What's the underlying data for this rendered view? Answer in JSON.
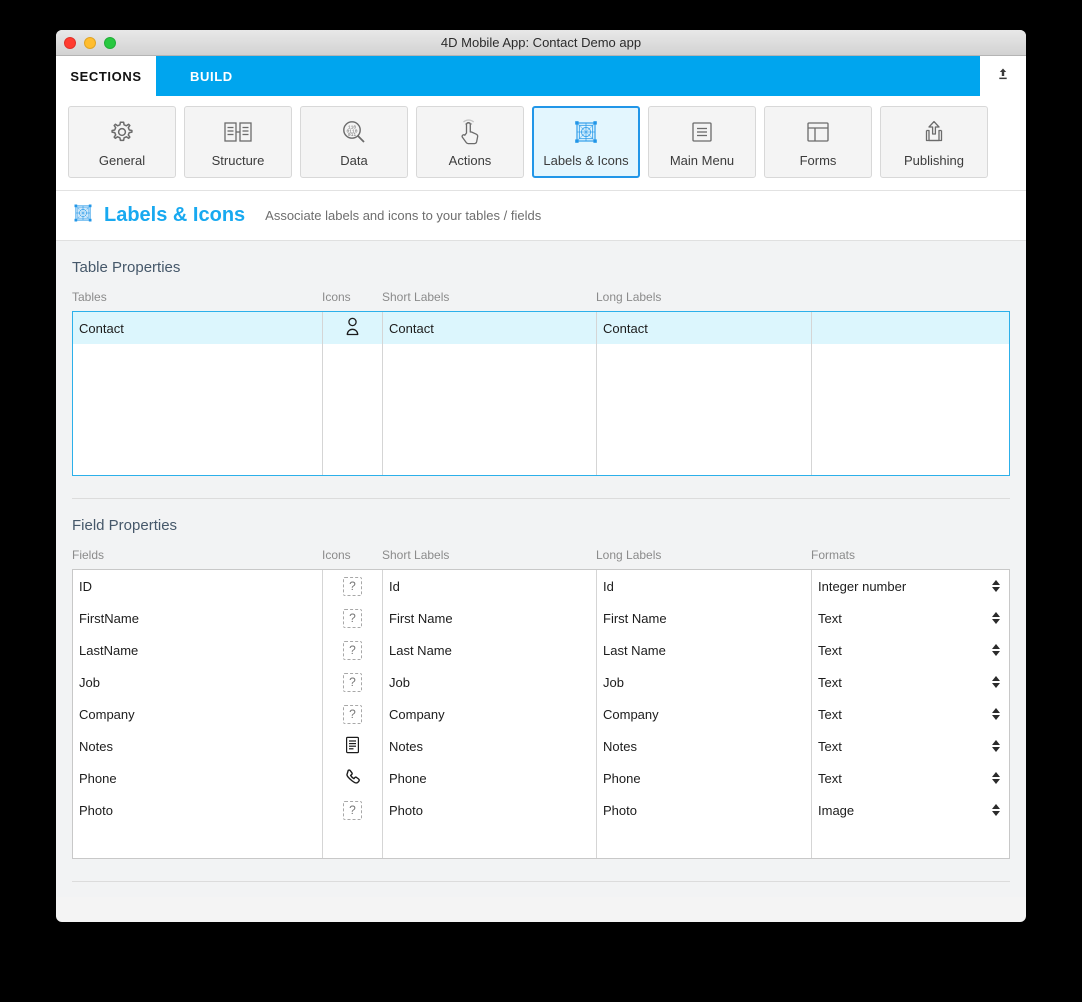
{
  "window": {
    "title": "4D Mobile App: Contact Demo app",
    "traffic_lights": [
      "close-button",
      "minimize-button",
      "zoom-button"
    ]
  },
  "tabs": [
    {
      "label": "SECTIONS",
      "active": true
    },
    {
      "label": "BUILD",
      "active": false
    }
  ],
  "upload_icon": "upload-icon",
  "toolbar": [
    {
      "label": "General",
      "icon": "gear-icon",
      "selected": false
    },
    {
      "label": "Structure",
      "icon": "structure-icon",
      "selected": false
    },
    {
      "label": "Data",
      "icon": "data-magnifier-icon",
      "selected": false
    },
    {
      "label": "Actions",
      "icon": "tap-hand-icon",
      "selected": false
    },
    {
      "label": "Labels & Icons",
      "icon": "labels-icons-icon",
      "selected": true
    },
    {
      "label": "Main Menu",
      "icon": "menu-list-icon",
      "selected": false
    },
    {
      "label": "Forms",
      "icon": "forms-layout-icon",
      "selected": false
    },
    {
      "label": "Publishing",
      "icon": "publish-upload-icon",
      "selected": false
    }
  ],
  "section": {
    "icon": "labels-icons-icon",
    "title": "Labels & Icons",
    "subtitle": "Associate labels and icons to your tables / fields"
  },
  "table_properties": {
    "panel_title": "Table Properties",
    "headers": [
      "Tables",
      "Icons",
      "Short Labels",
      "Long Labels",
      ""
    ],
    "rows": [
      {
        "table": "Contact",
        "icon": "person-icon",
        "short_label": "Contact",
        "long_label": "Contact",
        "extra": "",
        "selected": true
      }
    ]
  },
  "field_properties": {
    "panel_title": "Field Properties",
    "headers": [
      "Fields",
      "Icons",
      "Short Labels",
      "Long Labels",
      "Formats"
    ],
    "rows": [
      {
        "field": "ID",
        "icon": "question-placeholder-icon",
        "short_label": "Id",
        "long_label": "Id",
        "format": "Integer number"
      },
      {
        "field": "FirstName",
        "icon": "question-placeholder-icon",
        "short_label": "First Name",
        "long_label": "First Name",
        "format": "Text"
      },
      {
        "field": "LastName",
        "icon": "question-placeholder-icon",
        "short_label": "Last Name",
        "long_label": "Last Name",
        "format": "Text"
      },
      {
        "field": "Job",
        "icon": "question-placeholder-icon",
        "short_label": "Job",
        "long_label": "Job",
        "format": "Text"
      },
      {
        "field": "Company",
        "icon": "question-placeholder-icon",
        "short_label": "Company",
        "long_label": "Company",
        "format": "Text"
      },
      {
        "field": "Notes",
        "icon": "notes-document-icon",
        "short_label": "Notes",
        "long_label": "Notes",
        "format": "Text"
      },
      {
        "field": "Phone",
        "icon": "phone-handset-icon",
        "short_label": "Phone",
        "long_label": "Phone",
        "format": "Text"
      },
      {
        "field": "Photo",
        "icon": "question-placeholder-icon",
        "short_label": "Photo",
        "long_label": "Photo",
        "format": "Image"
      }
    ]
  },
  "colors": {
    "accent_blue": "#00a5ee",
    "title_blue": "#18a9f0",
    "selection_cyan": "#dcf6fd",
    "selection_border": "#2cb0ea",
    "panel_bg": "#f2f3f4"
  }
}
